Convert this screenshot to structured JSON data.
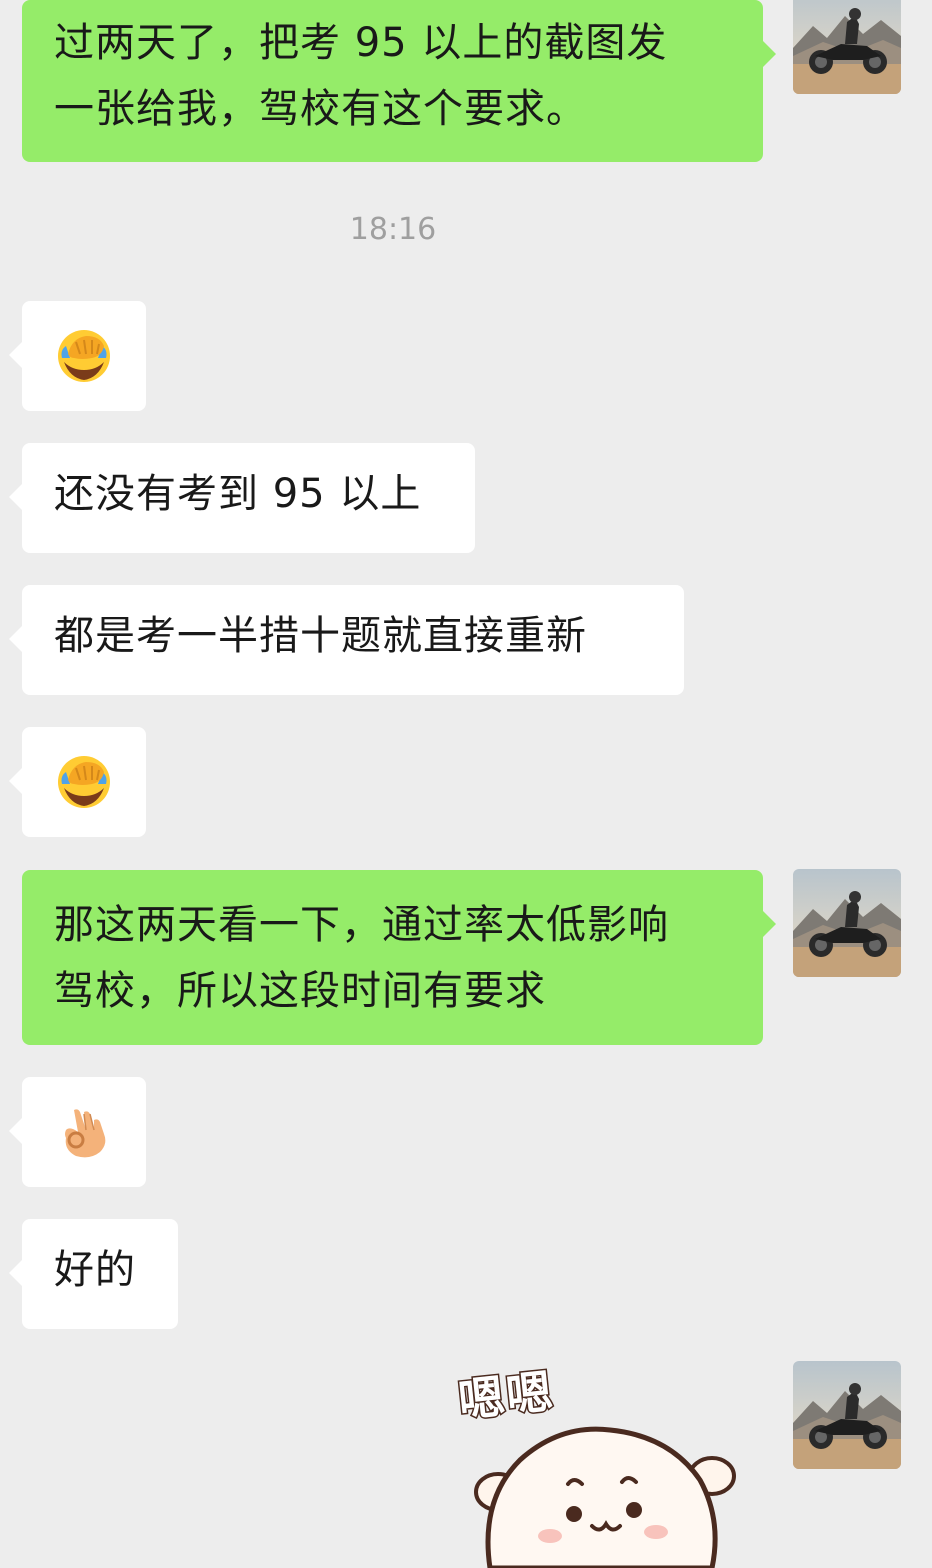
{
  "messages": [
    {
      "type": "out",
      "text_line1": "过两天了，把考 95 以上的截图发",
      "text_line2": "一张给我，驾校有这个要求。"
    },
    {
      "type": "timestamp",
      "text": "18:16"
    },
    {
      "type": "in",
      "emoji": "facepalm-emoji"
    },
    {
      "type": "in",
      "text": "还没有考到 95 以上"
    },
    {
      "type": "in",
      "text": "都是考一半措十题就直接重新"
    },
    {
      "type": "in",
      "emoji": "facepalm-emoji"
    },
    {
      "type": "out",
      "text_line1": "那这两天看一下，通过率太低影响",
      "text_line2": "驾校，所以这段时间有要求"
    },
    {
      "type": "in",
      "emoji": "ok-hand-emoji"
    },
    {
      "type": "in",
      "text": "好的"
    },
    {
      "type": "out",
      "sticker": "nod-sticker",
      "sticker_text": "嗯嗯"
    }
  ],
  "avatar": {
    "icon": "motorcycle-avatar-icon"
  },
  "colors": {
    "background": "#EDEDED",
    "outgoing_bubble": "#95EC69",
    "incoming_bubble": "#FFFFFF",
    "timestamp": "#9F9F9F"
  }
}
